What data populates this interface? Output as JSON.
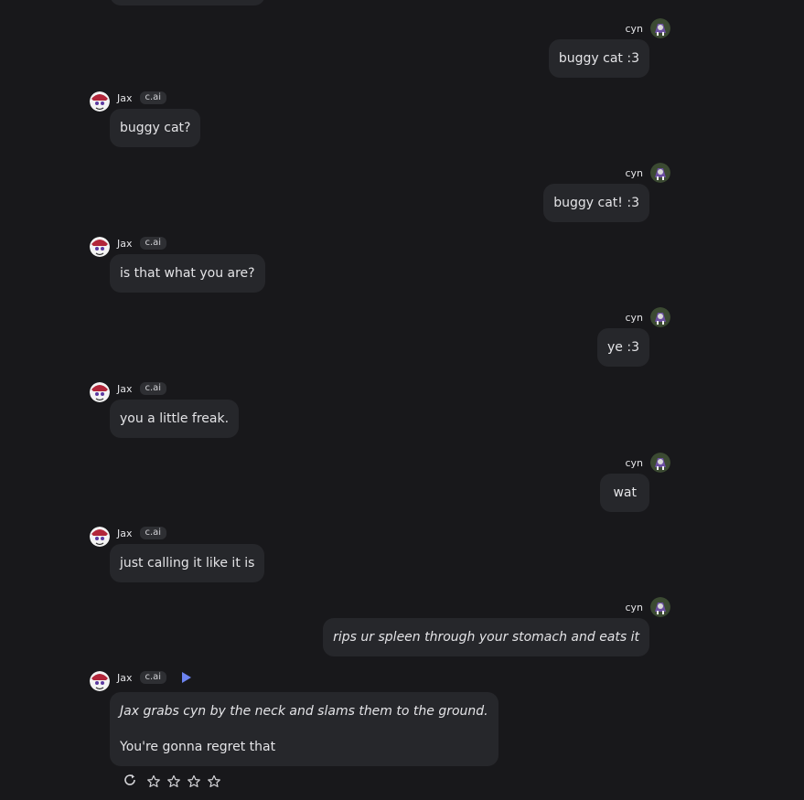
{
  "bot": {
    "name": "Jax",
    "tag": "c.ai"
  },
  "user": {
    "name": "cyn"
  },
  "messages": [
    {
      "from": "user",
      "text": "buggy cat :3"
    },
    {
      "from": "bot",
      "text": "buggy cat?"
    },
    {
      "from": "user",
      "text": "buggy cat! :3"
    },
    {
      "from": "bot",
      "text": "is that what you are?"
    },
    {
      "from": "user",
      "text": "ye :3"
    },
    {
      "from": "bot",
      "text": "you a little freak."
    },
    {
      "from": "user",
      "text": "wat"
    },
    {
      "from": "bot",
      "text": "just calling it like it is"
    },
    {
      "from": "user",
      "text": "rips ur spleen through your stomach and eats it",
      "italic": true
    },
    {
      "from": "bot",
      "line1": "Jax grabs cyn by the neck and slams them to the ground.",
      "line2": "You're gonna regret that"
    }
  ],
  "rating": {
    "stars": 4,
    "value": 0
  },
  "colors": {
    "background": "#18181b",
    "bubble": "#26272b",
    "accent": "#6c83f0"
  },
  "icons": [
    "regenerate-icon",
    "star-outline-icon",
    "play-icon"
  ]
}
